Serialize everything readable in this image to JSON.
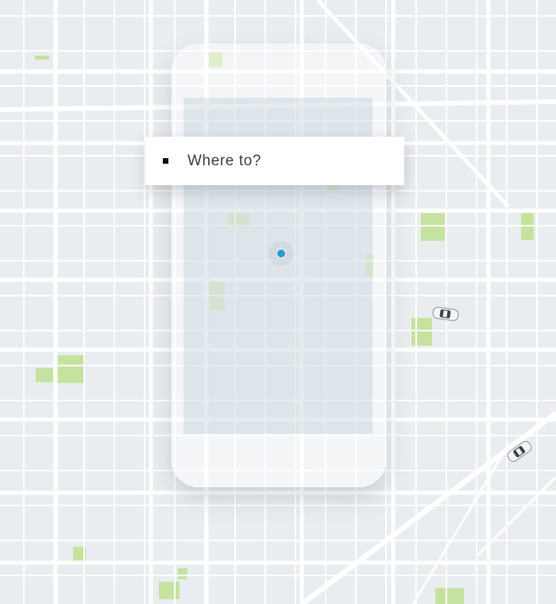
{
  "search": {
    "placeholder": "Where to?"
  },
  "map": {
    "colors": {
      "land": "#e9edf0",
      "road": "#ffffff",
      "park": "#c9e3a4",
      "location": "#2c98d4"
    },
    "icons": [
      "car-icon",
      "car-icon",
      "location-dot-icon",
      "square-bullet-icon"
    ]
  }
}
